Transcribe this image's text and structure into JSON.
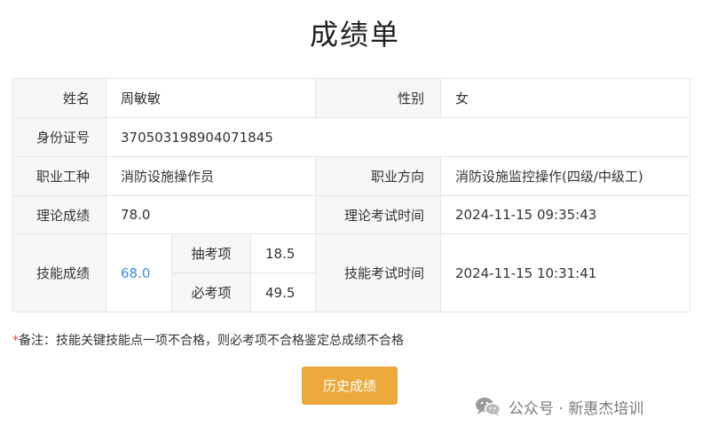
{
  "title": "成绩单",
  "rows": {
    "name_label": "姓名",
    "name_value": "周敏敏",
    "gender_label": "性别",
    "gender_value": "女",
    "id_label": "身份证号",
    "id_value": "370503198904071845",
    "job_label": "职业工种",
    "job_value": "消防设施操作员",
    "direction_label": "职业方向",
    "direction_value": "消防设施监控操作(四级/中级工)",
    "theory_label": "理论成绩",
    "theory_value": "78.0",
    "theory_time_label": "理论考试时间",
    "theory_time_value": "2024-11-15 09:35:43",
    "skill_label": "技能成绩",
    "skill_value": "68.0",
    "draw_label": "抽考项",
    "draw_value": "18.5",
    "required_label": "必考项",
    "required_value": "49.5",
    "skill_time_label": "技能考试时间",
    "skill_time_value": "2024-11-15 10:31:41"
  },
  "note": {
    "star": "*",
    "text": "备注：技能关键技能点一项不合格，则必考项不合格鉴定总成绩不合格"
  },
  "history_button": "历史成绩",
  "watermark": {
    "text": "公众号 · 新惠杰培训",
    "icon": "wechat-icon"
  },
  "colors": {
    "accent_button": "#eaa93a",
    "skill_score": "#3a8ee6",
    "note_star": "#e0473d",
    "label_bg": "#f7f7f7"
  }
}
